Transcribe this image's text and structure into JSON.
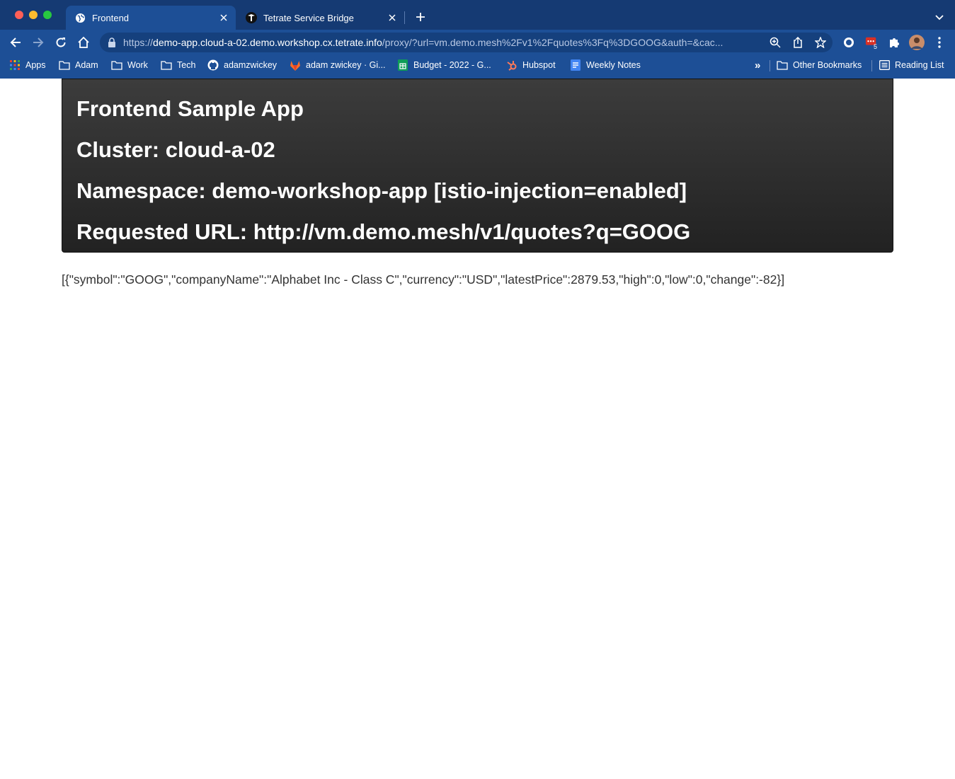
{
  "browser": {
    "tabs": [
      {
        "label": "Frontend",
        "active": true,
        "icon": "globe-icon"
      },
      {
        "label": "Tetrate Service Bridge",
        "active": false,
        "icon": "tetrate-logo-icon"
      }
    ],
    "url": {
      "scheme": "https://",
      "host": "demo-app.cloud-a-02.demo.workshop.cx.tetrate.info",
      "path": "/proxy/?url=vm.demo.mesh%2Fv1%2Fquotes%3Fq%3DGOOG&auth=&cac..."
    },
    "extension_badge": "5",
    "bookmarks": [
      {
        "label": "Apps",
        "icon": "apps-grid-icon"
      },
      {
        "label": "Adam",
        "icon": "folder-icon"
      },
      {
        "label": "Work",
        "icon": "folder-icon"
      },
      {
        "label": "Tech",
        "icon": "folder-icon"
      },
      {
        "label": "adamzwickey",
        "icon": "github-icon"
      },
      {
        "label": "adam zwickey · Gi...",
        "icon": "gitlab-icon"
      },
      {
        "label": "Budget - 2022 - G...",
        "icon": "sheets-icon"
      },
      {
        "label": "Hubspot",
        "icon": "hubspot-icon"
      },
      {
        "label": "Weekly Notes",
        "icon": "docs-icon"
      }
    ],
    "other_bookmarks": "Other Bookmarks",
    "reading_list": "Reading List",
    "overflow": "»"
  },
  "page": {
    "title": "Frontend Sample App",
    "cluster": "Cluster: cloud-a-02",
    "namespace": "Namespace: demo-workshop-app [istio-injection=enabled]",
    "requested_url": "Requested URL: http://vm.demo.mesh/v1/quotes?q=GOOG",
    "response": "[{\"symbol\":\"GOOG\",\"companyName\":\"Alphabet Inc - Class C\",\"currency\":\"USD\",\"latestPrice\":2879.53,\"high\":0,\"low\":0,\"change\":-82}]"
  },
  "colors": {
    "chrome": "#1d4f96",
    "titlebar": "#153a73",
    "jumbotron": "#2c2c2c"
  }
}
